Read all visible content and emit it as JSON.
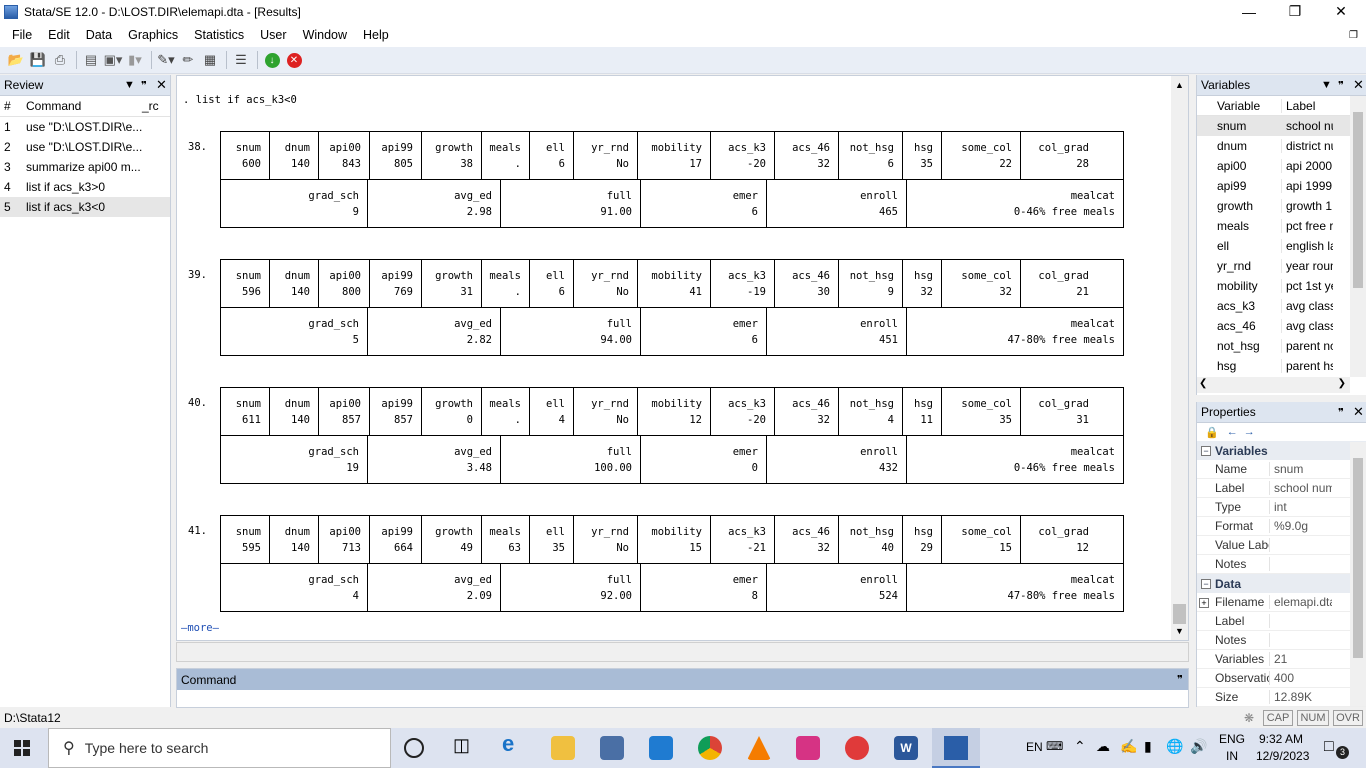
{
  "window": {
    "title": "Stata/SE 12.0 - D:\\LOST.DIR\\elemapi.dta - [Results]"
  },
  "menu": [
    "File",
    "Edit",
    "Data",
    "Graphics",
    "Statistics",
    "User",
    "Window",
    "Help"
  ],
  "review": {
    "title": "Review",
    "cols": [
      "#",
      "Command",
      "_rc"
    ],
    "rows": [
      {
        "n": "1",
        "cmd": "use \"D:\\LOST.DIR\\e..."
      },
      {
        "n": "2",
        "cmd": "use \"D:\\LOST.DIR\\e..."
      },
      {
        "n": "3",
        "cmd": "summarize api00 m..."
      },
      {
        "n": "4",
        "cmd": "list if acs_k3>0"
      },
      {
        "n": "5",
        "cmd": "list if acs_k3<0"
      }
    ]
  },
  "results": {
    "command": ". list if acs_k3<0",
    "headers1": [
      "snum",
      "dnum",
      "api00",
      "api99",
      "growth",
      "meals",
      "ell",
      "yr_rnd",
      "mobility",
      "acs_k3",
      "acs_46",
      "not_hsg",
      "hsg",
      "some_col",
      "col_grad"
    ],
    "headers2": [
      "grad_sch",
      "avg_ed",
      "full",
      "emer",
      "enroll",
      "mealcat"
    ],
    "records": [
      {
        "num": "38.",
        "r1": [
          "600",
          "140",
          "843",
          "805",
          "38",
          ".",
          "6",
          "No",
          "17",
          "-20",
          "32",
          "6",
          "35",
          "22",
          "28"
        ],
        "r2": [
          "9",
          "2.98",
          "91.00",
          "6",
          "465",
          "0-46% free meals"
        ]
      },
      {
        "num": "39.",
        "r1": [
          "596",
          "140",
          "800",
          "769",
          "31",
          ".",
          "6",
          "No",
          "41",
          "-19",
          "30",
          "9",
          "32",
          "32",
          "21"
        ],
        "r2": [
          "5",
          "2.82",
          "94.00",
          "6",
          "451",
          "47-80% free meals"
        ]
      },
      {
        "num": "40.",
        "r1": [
          "611",
          "140",
          "857",
          "857",
          "0",
          ".",
          "4",
          "No",
          "12",
          "-20",
          "32",
          "4",
          "11",
          "35",
          "31"
        ],
        "r2": [
          "19",
          "3.48",
          "100.00",
          "0",
          "432",
          "0-46% free meals"
        ]
      },
      {
        "num": "41.",
        "r1": [
          "595",
          "140",
          "713",
          "664",
          "49",
          "63",
          "35",
          "No",
          "15",
          "-21",
          "32",
          "40",
          "29",
          "15",
          "12"
        ],
        "r2": [
          "4",
          "2.09",
          "92.00",
          "8",
          "524",
          "47-80% free meals"
        ]
      }
    ],
    "more": "—more—"
  },
  "command_panel": {
    "title": "Command"
  },
  "variables": {
    "title": "Variables",
    "cols": [
      "Variable",
      "Label"
    ],
    "rows": [
      {
        "name": "snum",
        "label": "school nu"
      },
      {
        "name": "dnum",
        "label": "district nu"
      },
      {
        "name": "api00",
        "label": "api 2000"
      },
      {
        "name": "api99",
        "label": "api 1999"
      },
      {
        "name": "growth",
        "label": "growth 1"
      },
      {
        "name": "meals",
        "label": "pct free r"
      },
      {
        "name": "ell",
        "label": "english la"
      },
      {
        "name": "yr_rnd",
        "label": "year roun"
      },
      {
        "name": "mobility",
        "label": "pct 1st ye"
      },
      {
        "name": "acs_k3",
        "label": "avg class"
      },
      {
        "name": "acs_46",
        "label": "avg class"
      },
      {
        "name": "not_hsg",
        "label": "parent nc"
      },
      {
        "name": "hsg",
        "label": "parent hs"
      }
    ]
  },
  "properties": {
    "title": "Properties",
    "sec_variables": "Variables",
    "var_rows": [
      {
        "k": "Name",
        "v": "snum"
      },
      {
        "k": "Label",
        "v": "school num"
      },
      {
        "k": "Type",
        "v": "int"
      },
      {
        "k": "Format",
        "v": "%9.0g"
      },
      {
        "k": "Value Label",
        "v": ""
      },
      {
        "k": "Notes",
        "v": ""
      }
    ],
    "sec_data": "Data",
    "data_rows": [
      {
        "k": "Filename",
        "v": "elemapi.dta"
      },
      {
        "k": "Label",
        "v": ""
      },
      {
        "k": "Notes",
        "v": ""
      },
      {
        "k": "Variables",
        "v": "21"
      },
      {
        "k": "Observations",
        "v": "400"
      },
      {
        "k": "Size",
        "v": "12.89K"
      }
    ]
  },
  "statusbar": {
    "path": "D:\\Stata12",
    "keys": [
      "CAP",
      "NUM",
      "OVR"
    ]
  },
  "taskbar": {
    "search_placeholder": "Type here to search",
    "lang1": "EN",
    "lang2": "ENG",
    "lang3": "IN",
    "time": "9:32 AM",
    "date": "12/9/2023",
    "notif_count": "3"
  }
}
